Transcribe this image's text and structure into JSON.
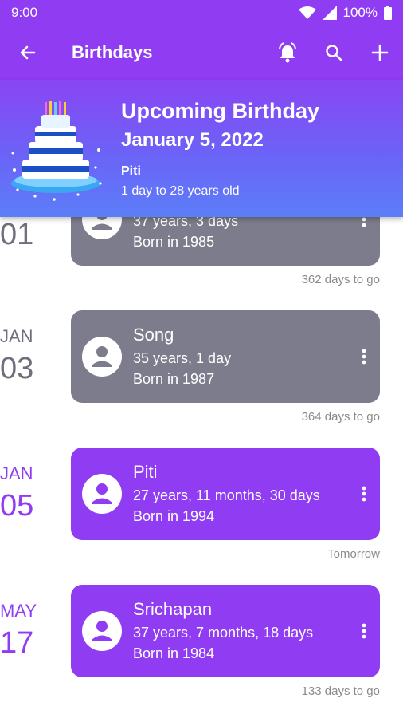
{
  "status_bar": {
    "time": "9:00",
    "battery": "100%"
  },
  "app_bar": {
    "title": "Birthdays",
    "icons": [
      "back-arrow-icon",
      "alarm-bell-icon",
      "search-icon",
      "add-icon"
    ]
  },
  "banner": {
    "title": "Upcoming Birthday",
    "date": "January 5, 2022",
    "name": "Piti",
    "subtitle": "1 day to 28 years old",
    "image": "birthday-cake-illustration"
  },
  "entries": [
    {
      "month": "",
      "day": "01",
      "name": "",
      "age": "37 years, 3 days",
      "born": "Born in 1985",
      "countdown": "362 days to go",
      "state": "past"
    },
    {
      "month": "JAN",
      "day": "03",
      "name": "Song",
      "age": "35 years, 1 day",
      "born": "Born in 1987",
      "countdown": "364 days to go",
      "state": "past"
    },
    {
      "month": "JAN",
      "day": "05",
      "name": "Piti",
      "age": "27 years, 11 months, 30 days",
      "born": "Born in 1994",
      "countdown": "Tomorrow",
      "state": "upcoming"
    },
    {
      "month": "MAY",
      "day": "17",
      "name": "Srichapan",
      "age": "37 years, 7 months, 18 days",
      "born": "Born in 1984",
      "countdown": "133 days to go",
      "state": "upcoming"
    }
  ],
  "colors": {
    "accent": "#8f3cf2",
    "past_card": "#7c7c8c",
    "banner_bottom": "#5c7ef8"
  }
}
